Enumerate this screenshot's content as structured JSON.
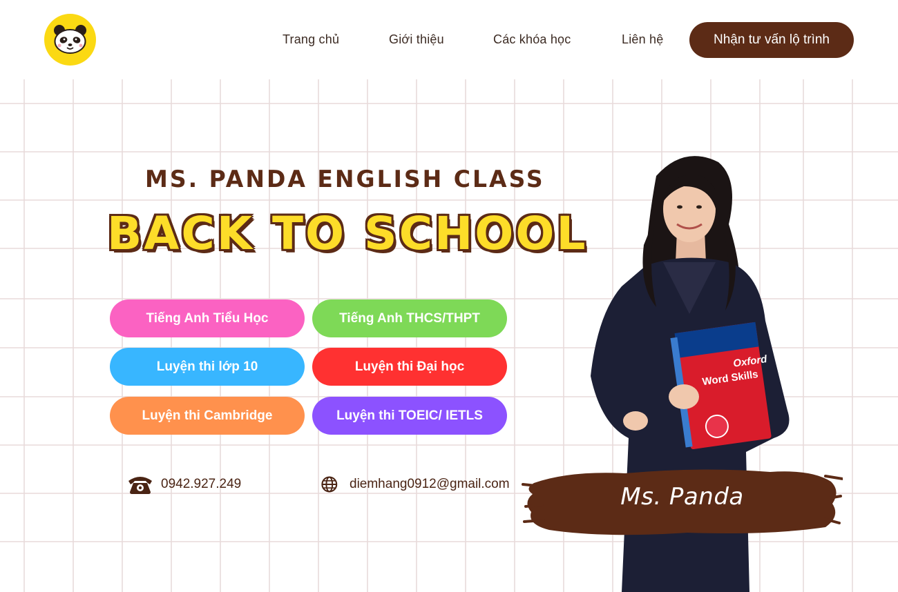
{
  "header": {
    "logo_icon": "panda-face-icon",
    "nav": [
      "Trang chủ",
      "Giới thiệu",
      "Các khóa học",
      "Liên hệ"
    ],
    "cta_label": "Nhận tư vấn lộ trình"
  },
  "hero": {
    "eyebrow": "MS. PANDA ENGLISH CLASS",
    "title": "BACK TO SCHOOL"
  },
  "courses": [
    {
      "label": "Tiếng Anh Tiểu Học",
      "color": "#fb62c2"
    },
    {
      "label": "Tiếng Anh THCS/THPT",
      "color": "#7ed957"
    },
    {
      "label": "Luyện thi lớp 10",
      "color": "#38b6ff"
    },
    {
      "label": "Luyện thi Đại học",
      "color": "#ff3131"
    },
    {
      "label": "Luyện thi Cambridge",
      "color": "#ff914d"
    },
    {
      "label": "Luyện thi TOEIC/ IETLS",
      "color": "#8c52ff"
    }
  ],
  "contact": {
    "phone_icon": "telephone-icon",
    "phone": "0942.927.249",
    "web_icon": "globe-icon",
    "email": "diemhang0912@gmail.com"
  },
  "teacher": {
    "name_label": "Ms. Panda",
    "book_brand": "Oxford",
    "book_title": "Word Skills"
  },
  "colors": {
    "brand_brown": "#5c2b16",
    "logo_yellow": "#fbd913",
    "title_yellow": "#fddd29",
    "grid_line": "#e8dada"
  }
}
